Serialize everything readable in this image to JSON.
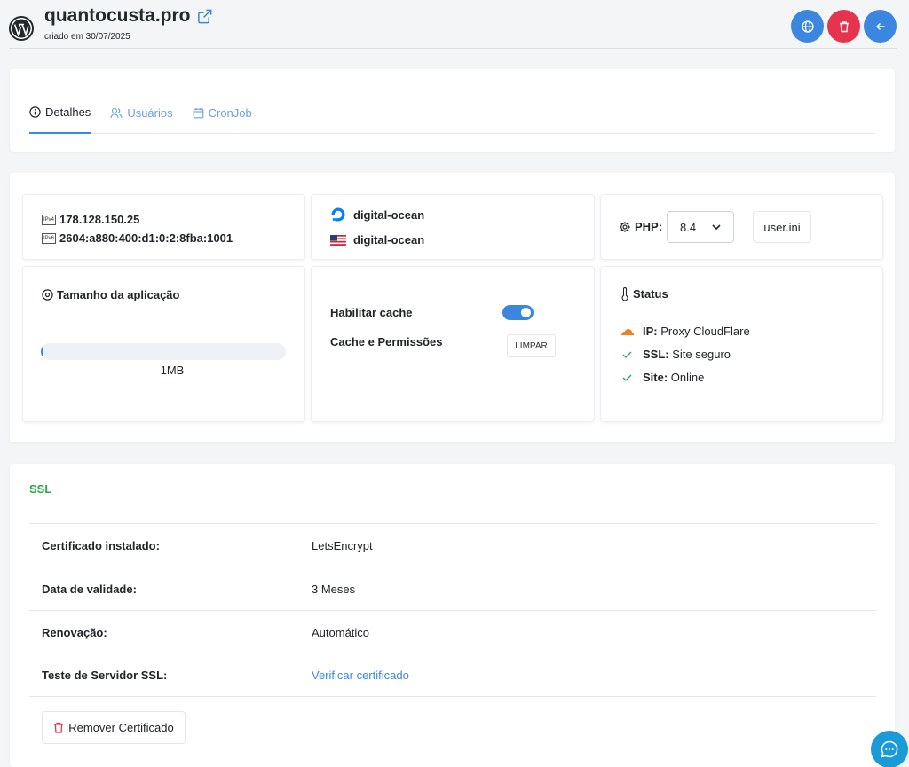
{
  "header": {
    "site_name": "quantocusta.pro",
    "created": "criado em 30/07/2025",
    "buttons": {
      "globe": "globe-icon",
      "delete": "trash-icon",
      "back": "arrow-left-icon"
    },
    "colors": {
      "primary": "#3b87e0",
      "danger": "#e6344f"
    }
  },
  "tabs": [
    {
      "label": "Detalhes",
      "icon": "info-icon",
      "active": true
    },
    {
      "label": "Usuários",
      "icon": "users-icon",
      "active": false
    },
    {
      "label": "CronJob",
      "icon": "calendar-icon",
      "active": false
    }
  ],
  "network": {
    "ipv4_badge": "IPv4",
    "ipv4": "178.128.150.25",
    "ipv6_badge": "IPv6",
    "ipv6": "2604:a880:400:d1:0:2:8fba:1001"
  },
  "provider": {
    "host": "digital-ocean",
    "region": "digital-ocean"
  },
  "php": {
    "label": "PHP:",
    "version": "8.4",
    "userini_label": "user.ini"
  },
  "app_size": {
    "title": "Tamanho da aplicação",
    "value": "1MB",
    "usage_fraction": 0.01
  },
  "cache": {
    "enable_label": "Habilitar cache",
    "enabled": true,
    "perms_label": "Cache e Permissões",
    "clear_label": "LIMPAR"
  },
  "status": {
    "title": "Status",
    "ip_label": "IP:",
    "ip_value": "Proxy CloudFlare",
    "ssl_label": "SSL:",
    "ssl_value": "Site seguro",
    "site_label": "Site:",
    "site_value": "Online",
    "colors": {
      "check": "#28a745",
      "cloudflare": "#f38020"
    }
  },
  "ssl": {
    "title": "SSL",
    "rows": [
      {
        "label": "Certificado instalado:",
        "value": "LetsEncrypt"
      },
      {
        "label": "Data de validade:",
        "value": "3 Meses"
      },
      {
        "label": "Renovação:",
        "value": "Automático"
      },
      {
        "label": "Teste de Servidor SSL:",
        "value": "Verificar certificado"
      }
    ],
    "remove_label": "Remover Certificado"
  }
}
